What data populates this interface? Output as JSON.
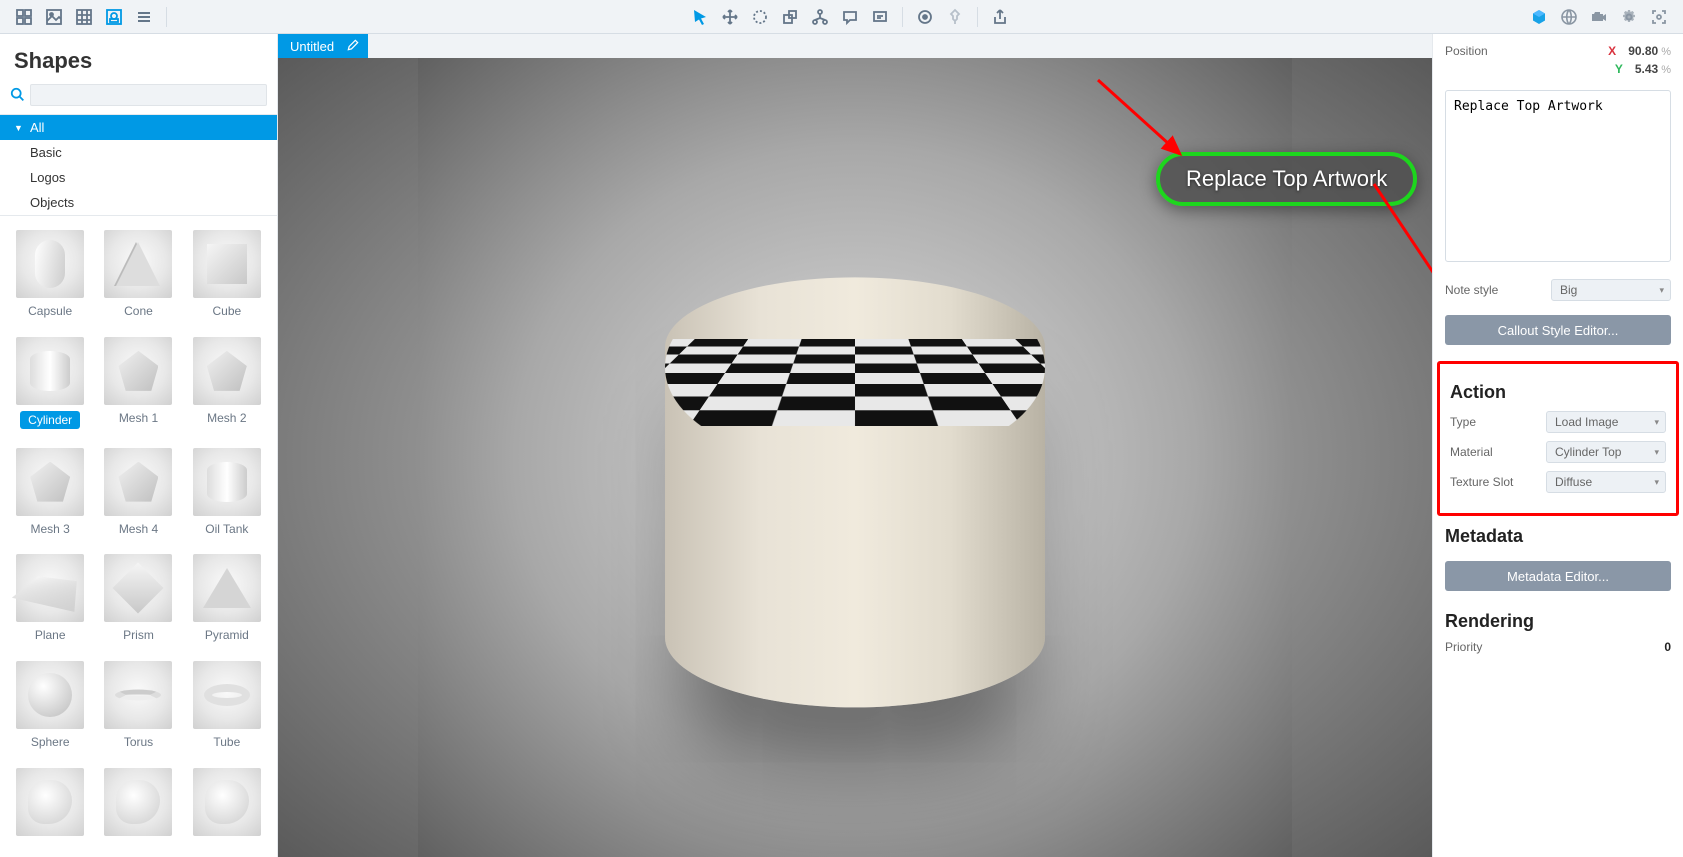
{
  "sidebar": {
    "title": "Shapes",
    "search_placeholder": "",
    "categories": [
      {
        "label": "All",
        "active": true
      },
      {
        "label": "Basic"
      },
      {
        "label": "Logos"
      },
      {
        "label": "Objects"
      }
    ],
    "shapes": [
      {
        "label": "Capsule",
        "kind": "capsule"
      },
      {
        "label": "Cone",
        "kind": "cone"
      },
      {
        "label": "Cube",
        "kind": "cube"
      },
      {
        "label": "Cylinder",
        "kind": "cyl",
        "selected": true
      },
      {
        "label": "Mesh 1",
        "kind": "poly"
      },
      {
        "label": "Mesh 2",
        "kind": "poly"
      },
      {
        "label": "Mesh 3",
        "kind": "poly"
      },
      {
        "label": "Mesh 4",
        "kind": "poly"
      },
      {
        "label": "Oil Tank",
        "kind": "cyl"
      },
      {
        "label": "Plane",
        "kind": "plane"
      },
      {
        "label": "Prism",
        "kind": "prism"
      },
      {
        "label": "Pyramid",
        "kind": "pyr"
      },
      {
        "label": "Sphere",
        "kind": "sphere"
      },
      {
        "label": "Torus",
        "kind": "torus"
      },
      {
        "label": "Tube",
        "kind": "tube"
      },
      {
        "label": "",
        "kind": "blob"
      },
      {
        "label": "",
        "kind": "blob"
      },
      {
        "label": "",
        "kind": "blob"
      }
    ]
  },
  "viewport": {
    "tab_label": "Untitled",
    "callout_text": "Replace Top Artwork"
  },
  "inspector": {
    "position_label": "Position",
    "pos_x": "90.80",
    "pos_y": "5.43",
    "pct_sign": "%",
    "note_text": "Replace Top Artwork",
    "note_style_label": "Note style",
    "note_style_value": "Big",
    "callout_editor_btn": "Callout Style Editor...",
    "action": {
      "title": "Action",
      "type_label": "Type",
      "type_value": "Load Image",
      "material_label": "Material",
      "material_value": "Cylinder Top",
      "slot_label": "Texture Slot",
      "slot_value": "Diffuse"
    },
    "metadata_title": "Metadata",
    "metadata_btn": "Metadata Editor...",
    "rendering_title": "Rendering",
    "priority_label": "Priority",
    "priority_value": "0"
  }
}
